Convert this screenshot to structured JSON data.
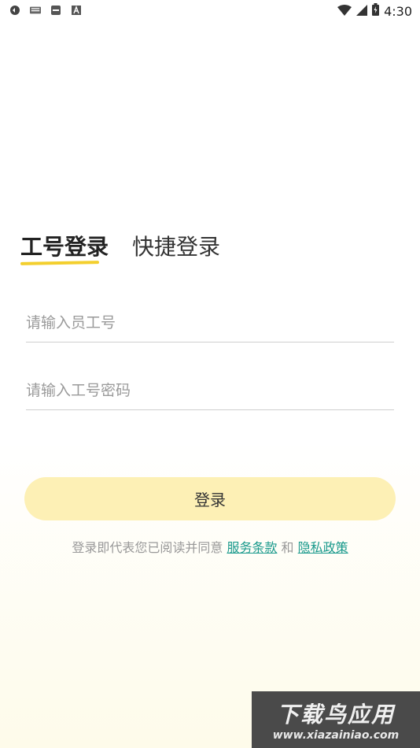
{
  "status_bar": {
    "time": "4:30",
    "left_icons": [
      "sync-icon",
      "keyboard-icon",
      "sd-card-icon",
      "font-a-icon"
    ],
    "right_icons": [
      "wifi-icon",
      "signal-icon",
      "battery-icon"
    ]
  },
  "tabs": [
    {
      "label": "工号登录",
      "active": true
    },
    {
      "label": "快捷登录",
      "active": false
    }
  ],
  "form": {
    "employee_id": {
      "placeholder": "请输入员工号",
      "value": ""
    },
    "password": {
      "placeholder": "请输入工号密码",
      "value": ""
    }
  },
  "login_button": {
    "label": "登录"
  },
  "agreement": {
    "prefix": "登录即代表您已阅读并同意",
    "terms_label": "服务条款",
    "conjunction": "和",
    "privacy_label": "隐私政策"
  },
  "watermark": {
    "title": "下载鸟应用",
    "url": "www.xiazainiao.com"
  },
  "colors": {
    "accent": "#f3cf2e",
    "button": "#fdf0b5",
    "link": "#1a9a8c"
  }
}
